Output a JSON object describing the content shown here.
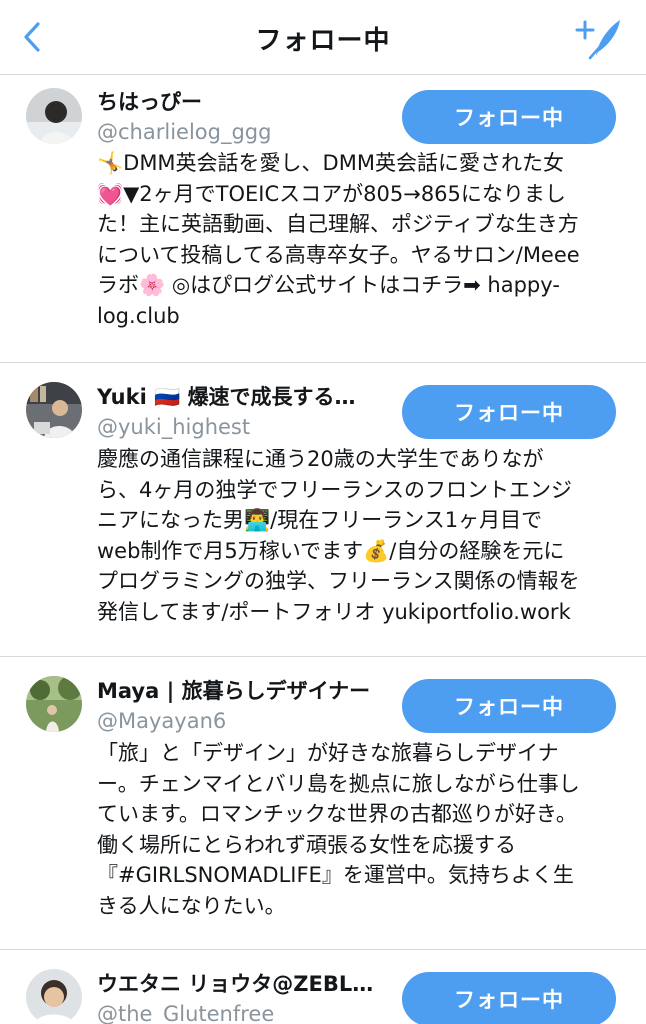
{
  "header": {
    "title": "フォロー中",
    "back_icon": "chevron-left-icon",
    "compose_icon": "add-feather-icon",
    "accent_color": "#4d9df0"
  },
  "users": [
    {
      "name": "ちはっぴー",
      "handle": "@charlielog_ggg",
      "follow_label": "フォロー中",
      "bio": "🤸DMM英会話を愛し、DMM英会話に愛された女\n💓▼2ヶ月でTOEICスコアが805→865になりまし\nた！主に英語動画、自己理解、ポジティブな生き方\nについて投稿してる高専卒女子。ヤるサロン/Meee\nラボ🌸 ◎はぴログ公式サイトはコチラ➡ happy-\nlog.club"
    },
    {
      "name": "Yuki 🇷🇺 爆速で成長する…",
      "handle": "@yuki_highest",
      "follow_label": "フォロー中",
      "bio": "慶應の通信課程に通う20歳の大学生でありなが\nら、4ヶ月の独学でフリーランスのフロントエンジ\nニアになった男👨‍💻/現在フリーランス1ヶ月目で\nweb制作で月5万稼いでます💰/自分の経験を元に\nプログラミングの独学、フリーランス関係の情報を\n発信してます/ポートフォリオ yukiportfolio.work"
    },
    {
      "name": "Maya | 旅暮らしデザイナー",
      "handle": "@Mayayan6",
      "follow_label": "フォロー中",
      "bio": "「旅」と「デザイン」が好きな旅暮らしデザイナ\nー。チェンマイとバリ島を拠点に旅しながら仕事し\nています。ロマンチックな世界の古都巡りが好き。\n働く場所にとらわれず頑張る女性を応援する\n『#GIRLSNOMADLIFE』を運営中。気持ちよく生\nきる人になりたい。"
    },
    {
      "name": "ウエタニ リョウタ@ZEBL…",
      "handle": "@the_Glutenfree",
      "follow_label": "フォロー中",
      "bio": ""
    }
  ]
}
